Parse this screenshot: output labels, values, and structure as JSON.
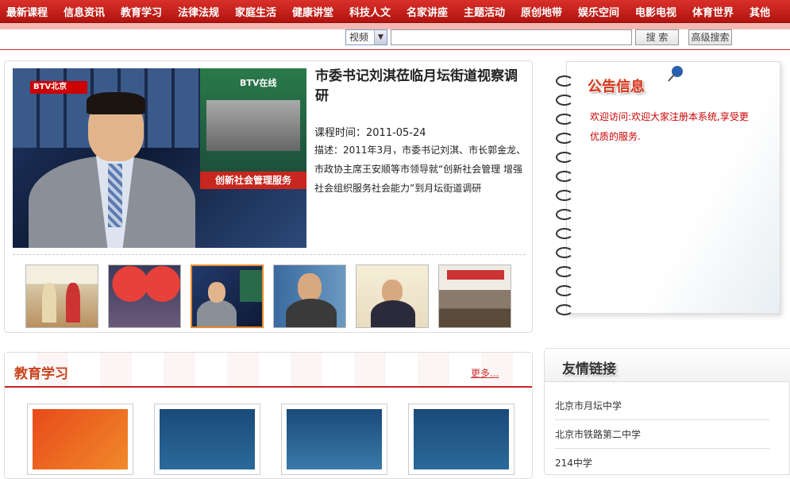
{
  "nav": {
    "items": [
      "最新课程",
      "信息资讯",
      "教育学习",
      "法律法规",
      "家庭生活",
      "健康讲堂",
      "科技人文",
      "名家讲座",
      "主题活动",
      "原创地带",
      "娱乐空间",
      "电影电视",
      "体育世界",
      "其他"
    ]
  },
  "search": {
    "select_value": "视频",
    "input_value": "",
    "search_button": "搜 索",
    "advanced_button": "高级搜索"
  },
  "featured": {
    "video_logo": "BTV北京",
    "video_inset_logo": "BTV在线",
    "video_banner": "创新社会管理服务",
    "title": "市委书记刘淇莅临月坛街道视察调研",
    "time_label": "课程时间：",
    "time_value": "2011-05-24",
    "desc": "描述：2011年3月，市委书记刘淇、市长郭金龙、市政协主席王安顺等市领导就“创新社会管理 增强社会组织服务社会能力”到月坛街道调研",
    "thumbnails": [
      "thumb-1",
      "thumb-2",
      "thumb-3",
      "thumb-4",
      "thumb-5",
      "thumb-6"
    ],
    "active_thumbnail": 3
  },
  "notice": {
    "title": "公告信息",
    "text": "欢迎访问:欢迎大家注册本系统,享受更优质的服务."
  },
  "education": {
    "title": "教育学习",
    "more": "更多..."
  },
  "links": {
    "title": "友情链接",
    "items": [
      "北京市月坛中学",
      "北京市铁路第二中学",
      "214中学"
    ]
  },
  "colors": {
    "nav_bg": "#c41f1a",
    "accent": "#c9441f",
    "notice_text": "#cc0000"
  }
}
